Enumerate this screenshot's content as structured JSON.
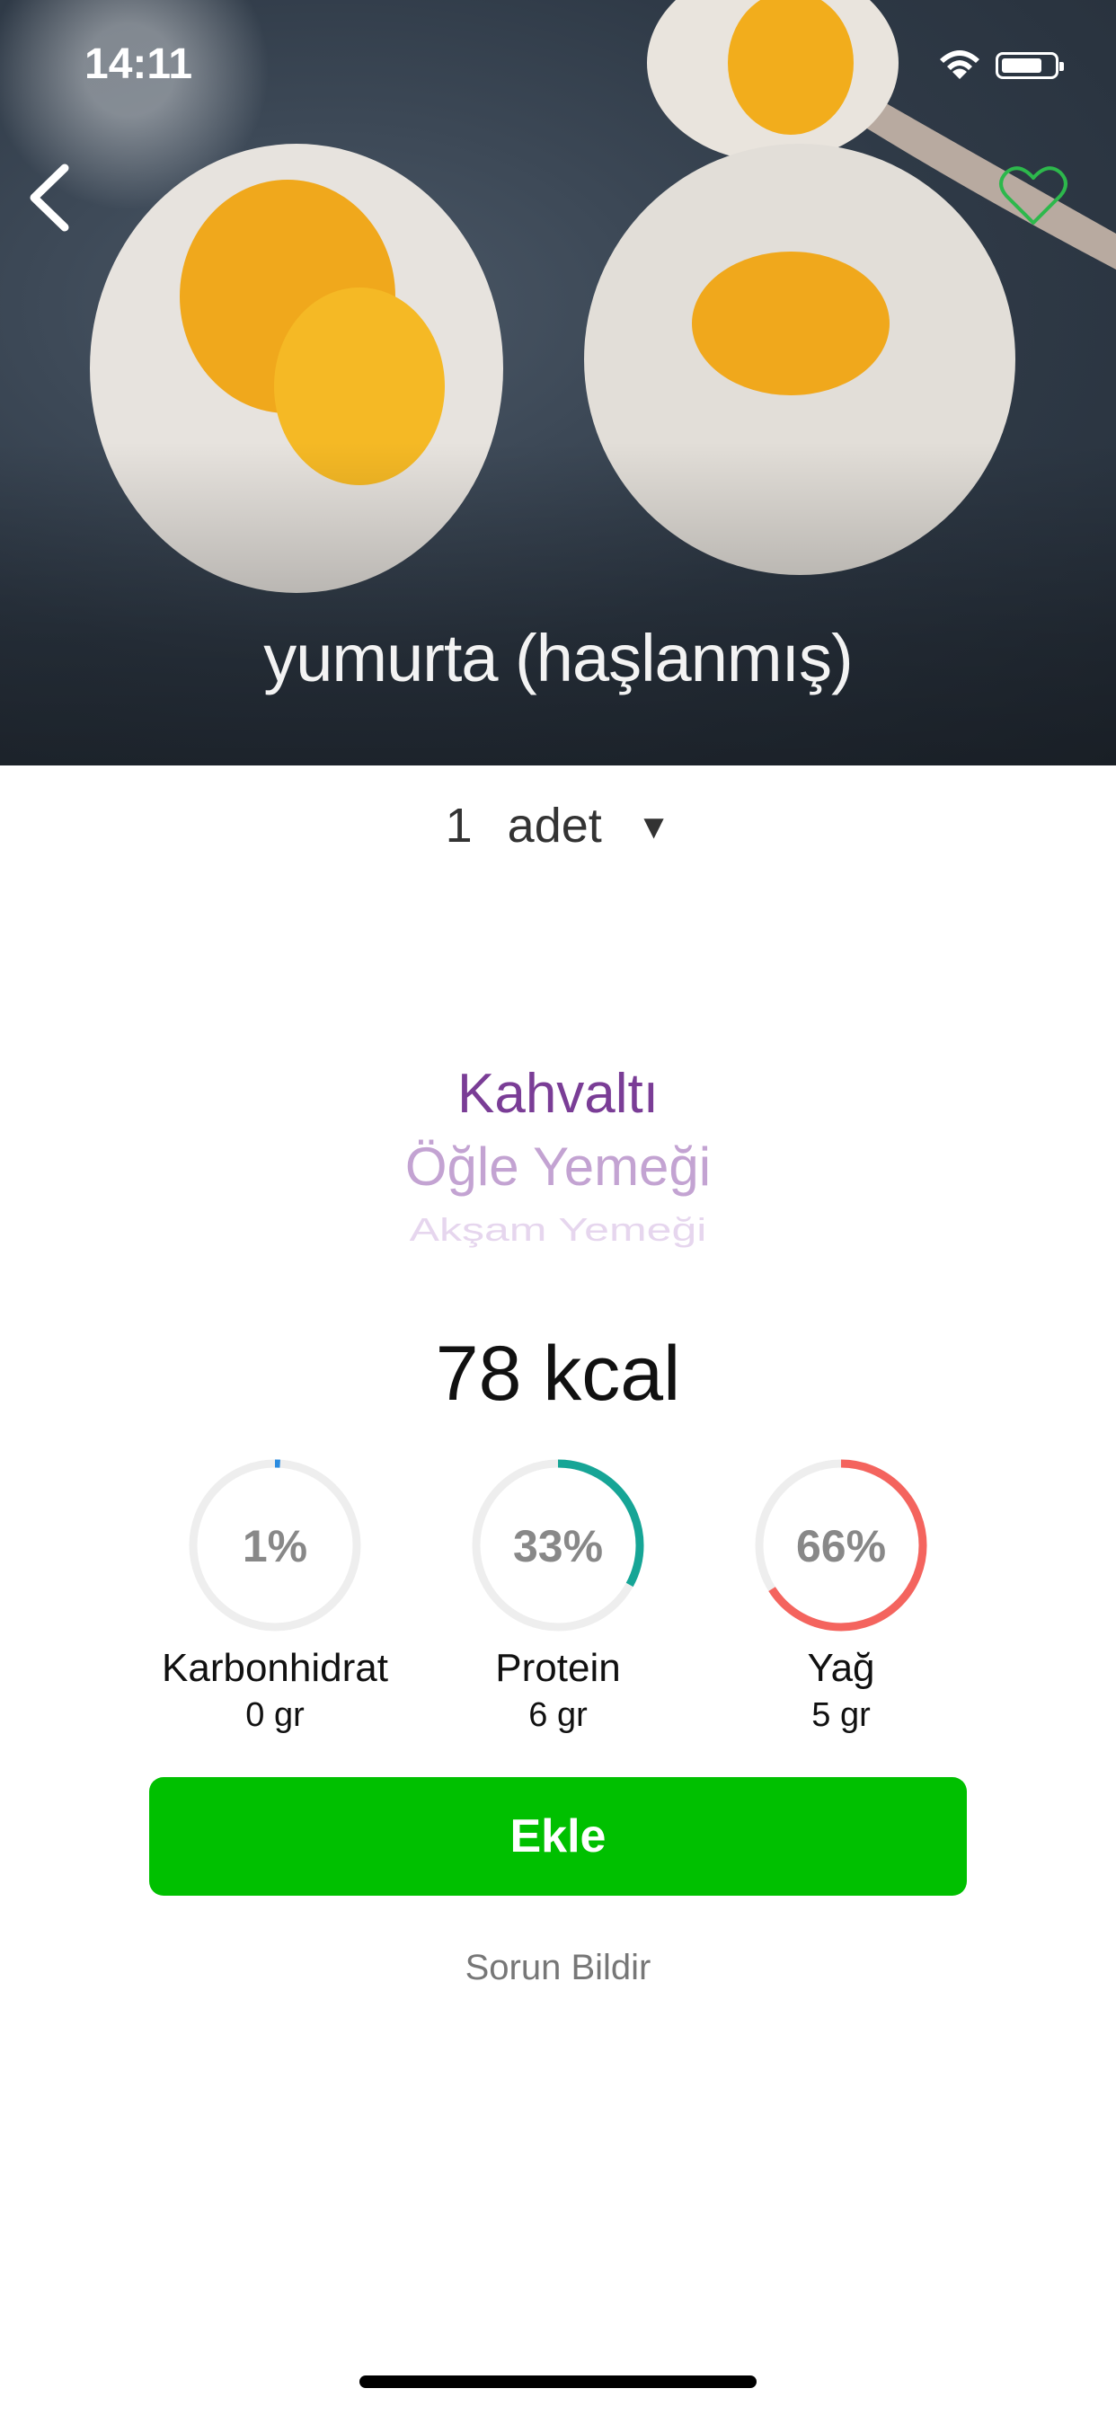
{
  "status_bar": {
    "time": "14:11"
  },
  "hero": {
    "title": "yumurta (haşlanmış)"
  },
  "portion": {
    "quantity": "1",
    "unit": "adet",
    "arrow": "▼"
  },
  "meal_picker": {
    "options": [
      "Kahvaltı",
      "Öğle Yemeği",
      "Akşam Yemeği"
    ],
    "selected": "Kahvaltı"
  },
  "calories": "78 kcal",
  "macros": [
    {
      "name": "Karbonhidrat",
      "percent_label": "1%",
      "percent": 1,
      "grams": "0 gr",
      "color": "#2a8be0"
    },
    {
      "name": "Protein",
      "percent_label": "33%",
      "percent": 33,
      "grams": "6 gr",
      "color": "#16a596"
    },
    {
      "name": "Yağ",
      "percent_label": "66%",
      "percent": 66,
      "grams": "5 gr",
      "color": "#f4645e"
    }
  ],
  "actions": {
    "add_label": "Ekle",
    "report_label": "Sorun Bildir"
  },
  "colors": {
    "add_button": "#00c000",
    "meal_selected": "#7a3d96",
    "favorite": "#2db84c"
  }
}
